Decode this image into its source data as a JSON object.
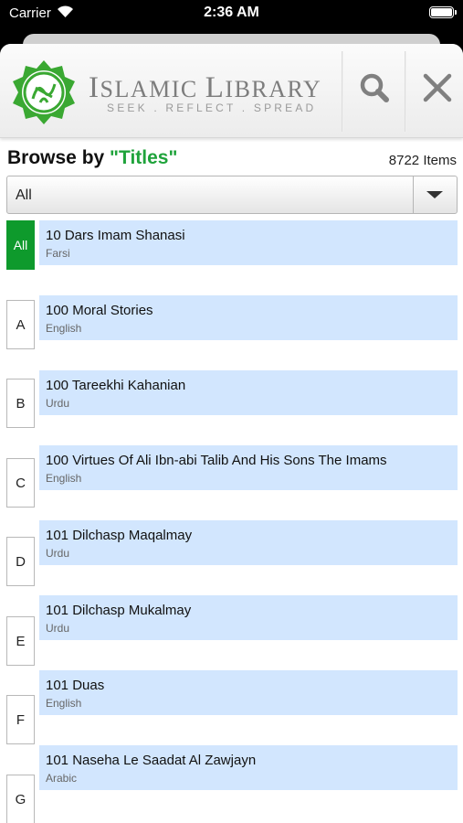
{
  "status_bar": {
    "carrier": "Carrier",
    "time": "2:36 AM"
  },
  "header": {
    "title_initial_1": "I",
    "title_rest_1": "SLAMIC ",
    "title_initial_2": "L",
    "title_rest_2": "IBRARY",
    "tagline": "SEEK . REFLECT . SPREAD",
    "logo": "islamic-library-logo",
    "search_icon": "search-icon",
    "close_icon": "close-icon"
  },
  "browse": {
    "prefix": "Browse by ",
    "category": "\"Titles\"",
    "count": "8722 Items"
  },
  "filter": {
    "selected": "All"
  },
  "alphabet": [
    "All",
    "A",
    "B",
    "C",
    "D",
    "E",
    "F",
    "G"
  ],
  "books": [
    {
      "title": "10 Dars Imam Shanasi",
      "language": "Farsi"
    },
    {
      "title": "100 Moral Stories",
      "language": "English"
    },
    {
      "title": "100 Tareekhi Kahanian",
      "language": "Urdu"
    },
    {
      "title": "100 Virtues Of Ali Ibn-abi Talib And His Sons The Imams",
      "language": "English"
    },
    {
      "title": "101 Dilchasp Maqalmay",
      "language": "Urdu"
    },
    {
      "title": "101 Dilchasp Mukalmay",
      "language": "Urdu"
    },
    {
      "title": "101 Duas",
      "language": "English"
    },
    {
      "title": "101 Naseha Le Saadat Al Zawjayn",
      "language": "Arabic"
    }
  ],
  "colors": {
    "accent_green": "#0e9a2c",
    "title_green": "#1fa33b",
    "row_blue": "#d2e6fe"
  }
}
